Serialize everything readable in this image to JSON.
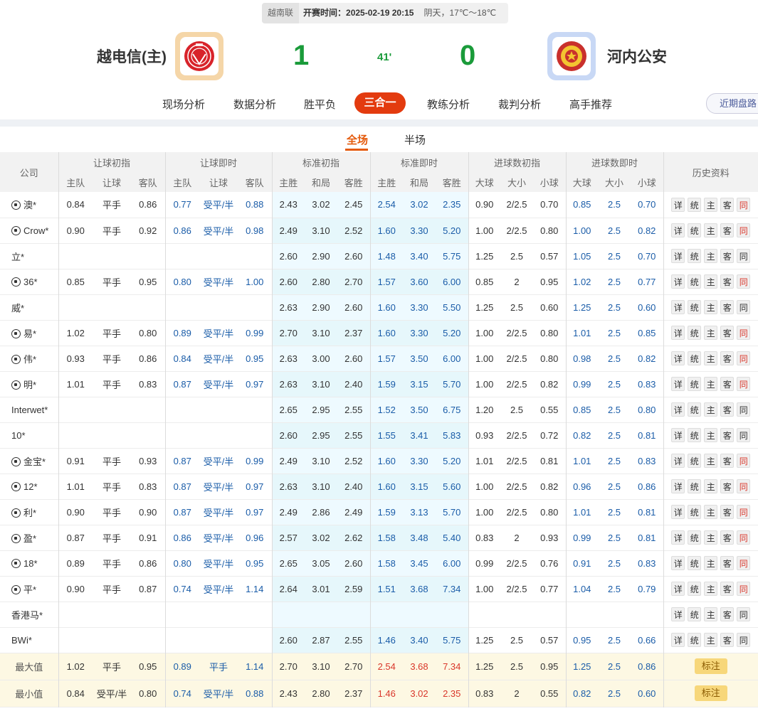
{
  "header": {
    "league": "越南联",
    "kickoff": "开赛时间：2025-02-19 20:15",
    "weather": "阴天，17℃～18℃",
    "home_team": "越电信(主)",
    "away_team": "河内公安",
    "home_score": "1",
    "away_score": "0",
    "minute": "41'",
    "colors": {
      "score": "#1a9b3a",
      "home_logo_ring": "#f5d6a8",
      "away_logo_ring": "#c8d8f5"
    }
  },
  "nav": {
    "tabs": [
      "现场分析",
      "数据分析",
      "胜平负",
      "三合一",
      "教练分析",
      "裁判分析",
      "高手推荐"
    ],
    "active": "三合一",
    "history_button": "近期盘路",
    "accent": "#e33b0f"
  },
  "subtabs": {
    "full": "全场",
    "half": "半场"
  },
  "table": {
    "company_header": "公司",
    "groups": [
      "让球初指",
      "让球即时",
      "标准初指",
      "标准即时",
      "进球数初指",
      "进球数即时",
      "历史资料"
    ],
    "sub_ah": [
      "主队",
      "让球",
      "客队"
    ],
    "sub_eu": [
      "主胜",
      "和局",
      "客胜"
    ],
    "sub_ou": [
      "大球",
      "大小",
      "小球"
    ],
    "hist_buttons": [
      "详",
      "统",
      "主",
      "客",
      "同"
    ],
    "rows": [
      {
        "icon": true,
        "name": "澳*",
        "ahi": [
          "0.84",
          "平手",
          "0.86"
        ],
        "ahl": [
          "0.77",
          "受平/半",
          "0.88"
        ],
        "eui": [
          "2.43",
          "3.02",
          "2.45"
        ],
        "eul": [
          "2.54",
          "3.02",
          "2.35"
        ],
        "oui": [
          "0.90",
          "2/2.5",
          "0.70"
        ],
        "oul": [
          "0.85",
          "2.5",
          "0.70"
        ],
        "tong_red": true
      },
      {
        "icon": true,
        "name": "Crow*",
        "ahi": [
          "0.90",
          "平手",
          "0.92"
        ],
        "ahl": [
          "0.86",
          "受平/半",
          "0.98"
        ],
        "eui": [
          "2.49",
          "3.10",
          "2.52"
        ],
        "eul": [
          "1.60",
          "3.30",
          "5.20"
        ],
        "oui": [
          "1.00",
          "2/2.5",
          "0.80"
        ],
        "oul": [
          "1.00",
          "2.5",
          "0.82"
        ],
        "tong_red": true
      },
      {
        "icon": false,
        "name": "立*",
        "ahi": [
          "",
          "",
          ""
        ],
        "ahl": [
          "",
          "",
          ""
        ],
        "eui": [
          "2.60",
          "2.90",
          "2.60"
        ],
        "eul": [
          "1.48",
          "3.40",
          "5.75"
        ],
        "oui": [
          "1.25",
          "2.5",
          "0.57"
        ],
        "oul": [
          "1.05",
          "2.5",
          "0.70"
        ],
        "tong_red": false
      },
      {
        "icon": true,
        "name": "36*",
        "ahi": [
          "0.85",
          "平手",
          "0.95"
        ],
        "ahl": [
          "0.80",
          "受平/半",
          "1.00"
        ],
        "eui": [
          "2.60",
          "2.80",
          "2.70"
        ],
        "eul": [
          "1.57",
          "3.60",
          "6.00"
        ],
        "oui": [
          "0.85",
          "2",
          "0.95"
        ],
        "oul": [
          "1.02",
          "2.5",
          "0.77"
        ],
        "tong_red": true
      },
      {
        "icon": false,
        "name": "威*",
        "ahi": [
          "",
          "",
          ""
        ],
        "ahl": [
          "",
          "",
          ""
        ],
        "eui": [
          "2.63",
          "2.90",
          "2.60"
        ],
        "eul": [
          "1.60",
          "3.30",
          "5.50"
        ],
        "oui": [
          "1.25",
          "2.5",
          "0.60"
        ],
        "oul": [
          "1.25",
          "2.5",
          "0.60"
        ],
        "tong_red": false
      },
      {
        "icon": true,
        "name": "易*",
        "ahi": [
          "1.02",
          "平手",
          "0.80"
        ],
        "ahl": [
          "0.89",
          "受平/半",
          "0.99"
        ],
        "eui": [
          "2.70",
          "3.10",
          "2.37"
        ],
        "eul": [
          "1.60",
          "3.30",
          "5.20"
        ],
        "oui": [
          "1.00",
          "2/2.5",
          "0.80"
        ],
        "oul": [
          "1.01",
          "2.5",
          "0.85"
        ],
        "tong_red": true
      },
      {
        "icon": true,
        "name": "伟*",
        "ahi": [
          "0.93",
          "平手",
          "0.86"
        ],
        "ahl": [
          "0.84",
          "受平/半",
          "0.95"
        ],
        "eui": [
          "2.63",
          "3.00",
          "2.60"
        ],
        "eul": [
          "1.57",
          "3.50",
          "6.00"
        ],
        "oui": [
          "1.00",
          "2/2.5",
          "0.80"
        ],
        "oul": [
          "0.98",
          "2.5",
          "0.82"
        ],
        "tong_red": true
      },
      {
        "icon": true,
        "name": "明*",
        "ahi": [
          "1.01",
          "平手",
          "0.83"
        ],
        "ahl": [
          "0.87",
          "受平/半",
          "0.97"
        ],
        "eui": [
          "2.63",
          "3.10",
          "2.40"
        ],
        "eul": [
          "1.59",
          "3.15",
          "5.70"
        ],
        "oui": [
          "1.00",
          "2/2.5",
          "0.82"
        ],
        "oul": [
          "0.99",
          "2.5",
          "0.83"
        ],
        "tong_red": true
      },
      {
        "icon": false,
        "name": "Interwet*",
        "ahi": [
          "",
          "",
          ""
        ],
        "ahl": [
          "",
          "",
          ""
        ],
        "eui": [
          "2.65",
          "2.95",
          "2.55"
        ],
        "eul": [
          "1.52",
          "3.50",
          "6.75"
        ],
        "oui": [
          "1.20",
          "2.5",
          "0.55"
        ],
        "oul": [
          "0.85",
          "2.5",
          "0.80"
        ],
        "tong_red": false
      },
      {
        "icon": false,
        "name": "10*",
        "ahi": [
          "",
          "",
          ""
        ],
        "ahl": [
          "",
          "",
          ""
        ],
        "eui": [
          "2.60",
          "2.95",
          "2.55"
        ],
        "eul": [
          "1.55",
          "3.41",
          "5.83"
        ],
        "oui": [
          "0.93",
          "2/2.5",
          "0.72"
        ],
        "oul": [
          "0.82",
          "2.5",
          "0.81"
        ],
        "tong_red": false
      },
      {
        "icon": true,
        "name": "金宝*",
        "ahi": [
          "0.91",
          "平手",
          "0.93"
        ],
        "ahl": [
          "0.87",
          "受平/半",
          "0.99"
        ],
        "eui": [
          "2.49",
          "3.10",
          "2.52"
        ],
        "eul": [
          "1.60",
          "3.30",
          "5.20"
        ],
        "oui": [
          "1.01",
          "2/2.5",
          "0.81"
        ],
        "oul": [
          "1.01",
          "2.5",
          "0.83"
        ],
        "tong_red": true
      },
      {
        "icon": true,
        "name": "12*",
        "ahi": [
          "1.01",
          "平手",
          "0.83"
        ],
        "ahl": [
          "0.87",
          "受平/半",
          "0.97"
        ],
        "eui": [
          "2.63",
          "3.10",
          "2.40"
        ],
        "eul": [
          "1.60",
          "3.15",
          "5.60"
        ],
        "oui": [
          "1.00",
          "2/2.5",
          "0.82"
        ],
        "oul": [
          "0.96",
          "2.5",
          "0.86"
        ],
        "tong_red": true
      },
      {
        "icon": true,
        "name": "利*",
        "ahi": [
          "0.90",
          "平手",
          "0.90"
        ],
        "ahl": [
          "0.87",
          "受平/半",
          "0.97"
        ],
        "eui": [
          "2.49",
          "2.86",
          "2.49"
        ],
        "eul": [
          "1.59",
          "3.13",
          "5.70"
        ],
        "oui": [
          "1.00",
          "2/2.5",
          "0.80"
        ],
        "oul": [
          "1.01",
          "2.5",
          "0.81"
        ],
        "tong_red": true
      },
      {
        "icon": true,
        "name": "盈*",
        "ahi": [
          "0.87",
          "平手",
          "0.91"
        ],
        "ahl": [
          "0.86",
          "受平/半",
          "0.96"
        ],
        "eui": [
          "2.57",
          "3.02",
          "2.62"
        ],
        "eul": [
          "1.58",
          "3.48",
          "5.40"
        ],
        "oui": [
          "0.83",
          "2",
          "0.93"
        ],
        "oul": [
          "0.99",
          "2.5",
          "0.81"
        ],
        "tong_red": true
      },
      {
        "icon": true,
        "name": "18*",
        "ahi": [
          "0.89",
          "平手",
          "0.86"
        ],
        "ahl": [
          "0.80",
          "受平/半",
          "0.95"
        ],
        "eui": [
          "2.65",
          "3.05",
          "2.60"
        ],
        "eul": [
          "1.58",
          "3.45",
          "6.00"
        ],
        "oui": [
          "0.99",
          "2/2.5",
          "0.76"
        ],
        "oul": [
          "0.91",
          "2.5",
          "0.83"
        ],
        "tong_red": true
      },
      {
        "icon": true,
        "name": "平*",
        "ahi": [
          "0.90",
          "平手",
          "0.87"
        ],
        "ahl": [
          "0.74",
          "受平/半",
          "1.14"
        ],
        "eui": [
          "2.64",
          "3.01",
          "2.59"
        ],
        "eul": [
          "1.51",
          "3.68",
          "7.34"
        ],
        "oui": [
          "1.00",
          "2/2.5",
          "0.77"
        ],
        "oul": [
          "1.04",
          "2.5",
          "0.79"
        ],
        "tong_red": true
      },
      {
        "icon": false,
        "name": "香港马*",
        "ahi": [
          "",
          "",
          ""
        ],
        "ahl": [
          "",
          "",
          ""
        ],
        "eui": [
          "",
          "",
          ""
        ],
        "eul": [
          "",
          "",
          ""
        ],
        "oui": [
          "",
          "",
          ""
        ],
        "oul": [
          "",
          "",
          ""
        ],
        "tong_red": false
      },
      {
        "icon": false,
        "name": "BWi*",
        "ahi": [
          "",
          "",
          ""
        ],
        "ahl": [
          "",
          "",
          ""
        ],
        "eui": [
          "2.60",
          "2.87",
          "2.55"
        ],
        "eul": [
          "1.46",
          "3.40",
          "5.75"
        ],
        "oui": [
          "1.25",
          "2.5",
          "0.57"
        ],
        "oul": [
          "0.95",
          "2.5",
          "0.66"
        ],
        "tong_red": false
      }
    ],
    "max_row": {
      "name": "最大值",
      "ahi": [
        "1.02",
        "平手",
        "0.95"
      ],
      "ahl": [
        "0.89",
        "平手",
        "1.14"
      ],
      "eui": [
        "2.70",
        "3.10",
        "2.70"
      ],
      "eul": [
        "2.54",
        "3.68",
        "7.34"
      ],
      "oui": [
        "1.25",
        "2.5",
        "0.95"
      ],
      "oul": [
        "1.25",
        "2.5",
        "0.86"
      ],
      "mark": "标注"
    },
    "min_row": {
      "name": "最小值",
      "ahi": [
        "0.84",
        "受平/半",
        "0.80"
      ],
      "ahl": [
        "0.74",
        "受平/半",
        "0.88"
      ],
      "eui": [
        "2.43",
        "2.80",
        "2.37"
      ],
      "eul": [
        "1.46",
        "3.02",
        "2.35"
      ],
      "oui": [
        "0.83",
        "2",
        "0.55"
      ],
      "oul": [
        "0.82",
        "2.5",
        "0.60"
      ],
      "mark": "标注"
    }
  }
}
